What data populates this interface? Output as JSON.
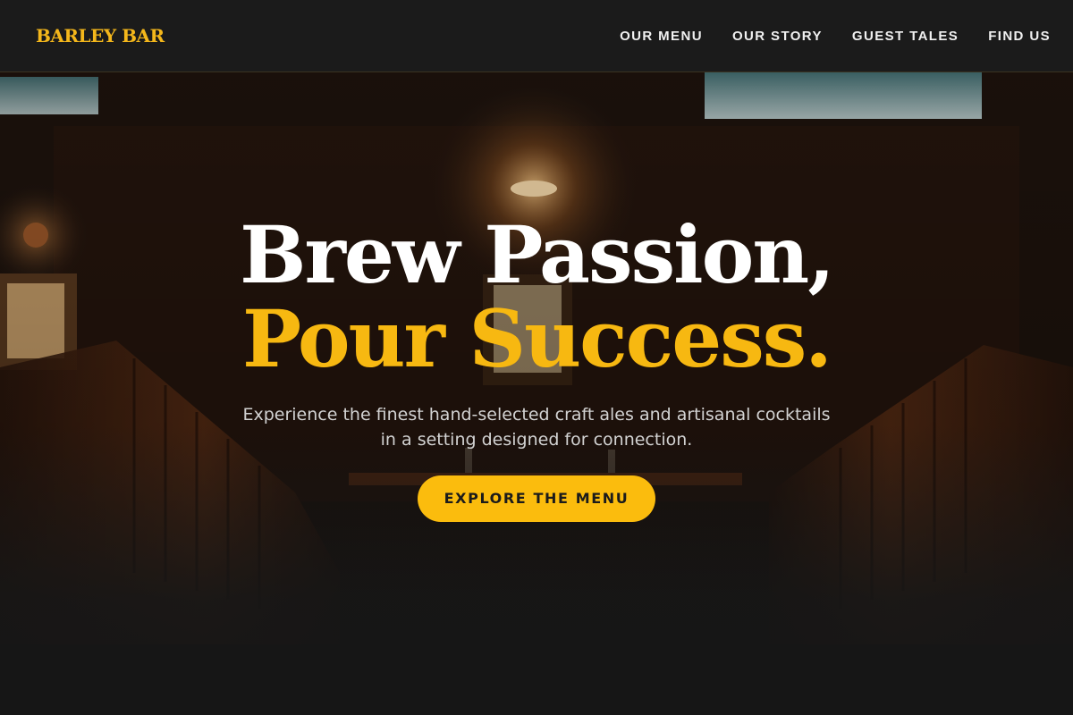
{
  "header": {
    "logo": "BARLEY BAR",
    "nav": [
      {
        "label": "OUR MENU"
      },
      {
        "label": "OUR STORY"
      },
      {
        "label": "GUEST TALES"
      },
      {
        "label": "FIND US"
      }
    ]
  },
  "hero": {
    "headline_line1": "Brew Passion,",
    "headline_line2": "Pour Success.",
    "tagline": "Experience the finest hand-selected craft ales and artisanal cocktails in a setting designed for connection.",
    "cta_label": "EXPLORE THE MENU"
  },
  "colors": {
    "accent": "#f7b811",
    "header_bg": "#1b1b1b",
    "page_bg": "#161616",
    "cta_bg": "#fbbc0d"
  }
}
